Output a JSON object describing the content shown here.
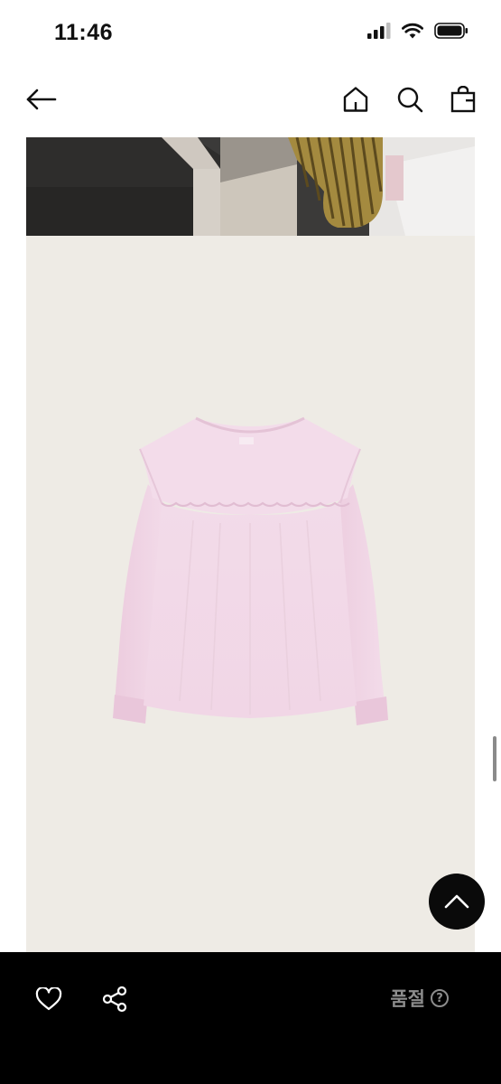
{
  "status_bar": {
    "time": "11:46"
  },
  "header": {
    "icons": [
      "back-arrow-icon",
      "home-icon",
      "search-icon",
      "shopping-bag-icon"
    ]
  },
  "content": {
    "images": [
      "lifestyle-photo",
      "pink-ruffle-blouse-product-photo"
    ]
  },
  "floating": {
    "icon": "chevron-up-icon"
  },
  "bottom_bar": {
    "icons": [
      "heart-icon",
      "share-icon",
      "help-icon"
    ],
    "soldout_label": "품절",
    "help_glyph": "?"
  },
  "colors": {
    "product_background": "#eeebe5",
    "blouse_pink": "#f0d5e6",
    "bottom_bar": "#000000",
    "soldout_text": "#8c8c8c"
  }
}
